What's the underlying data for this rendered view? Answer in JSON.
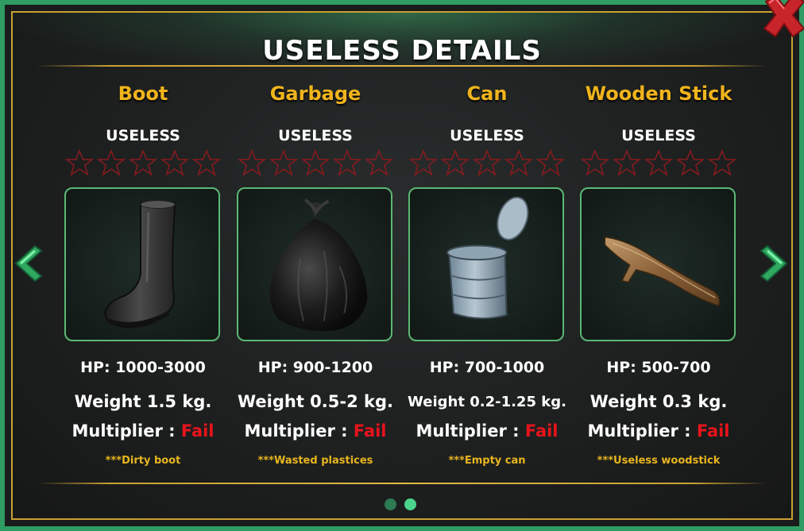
{
  "title": "USELESS DETAILS",
  "items": [
    {
      "name": "Boot",
      "rank": "USELESS",
      "stars_filled": 0,
      "stars_total": 5,
      "hp": "HP: 1000-3000",
      "weight": "Weight 1.5 kg.",
      "multiplier_label": "Multiplier :",
      "multiplier_value": "Fail",
      "note": "***Dirty boot",
      "image_icon": "boot-icon"
    },
    {
      "name": "Garbage",
      "rank": "USELESS",
      "stars_filled": 0,
      "stars_total": 5,
      "hp": "HP: 900-1200",
      "weight": "Weight 0.5-2 kg.",
      "multiplier_label": "Multiplier :",
      "multiplier_value": "Fail",
      "note": "***Wasted plastices",
      "image_icon": "garbage-bag-icon"
    },
    {
      "name": "Can",
      "rank": "USELESS",
      "stars_filled": 0,
      "stars_total": 5,
      "hp": "HP: 700-1000",
      "weight": "Weight 0.2-1.25 kg.",
      "multiplier_label": "Multiplier :",
      "multiplier_value": "Fail",
      "note": "***Empty can",
      "image_icon": "tin-can-icon"
    },
    {
      "name": "Wooden Stick",
      "rank": "USELESS",
      "stars_filled": 0,
      "stars_total": 5,
      "hp": "HP: 500-700",
      "weight": "Weight 0.3 kg.",
      "multiplier_label": "Multiplier :",
      "multiplier_value": "Fail",
      "note": "***Useless woodstick",
      "image_icon": "wooden-stick-icon"
    }
  ],
  "pagination": {
    "total": 2,
    "active": 2
  },
  "colors": {
    "accent_gold": "#f0b41c",
    "frame_green": "#2f9c63",
    "fail_red": "#e8131b",
    "star_outline": "#8a1a1e"
  },
  "icons": {
    "close": "close-x-icon",
    "prev": "chevron-left-icon",
    "next": "chevron-right-icon"
  }
}
